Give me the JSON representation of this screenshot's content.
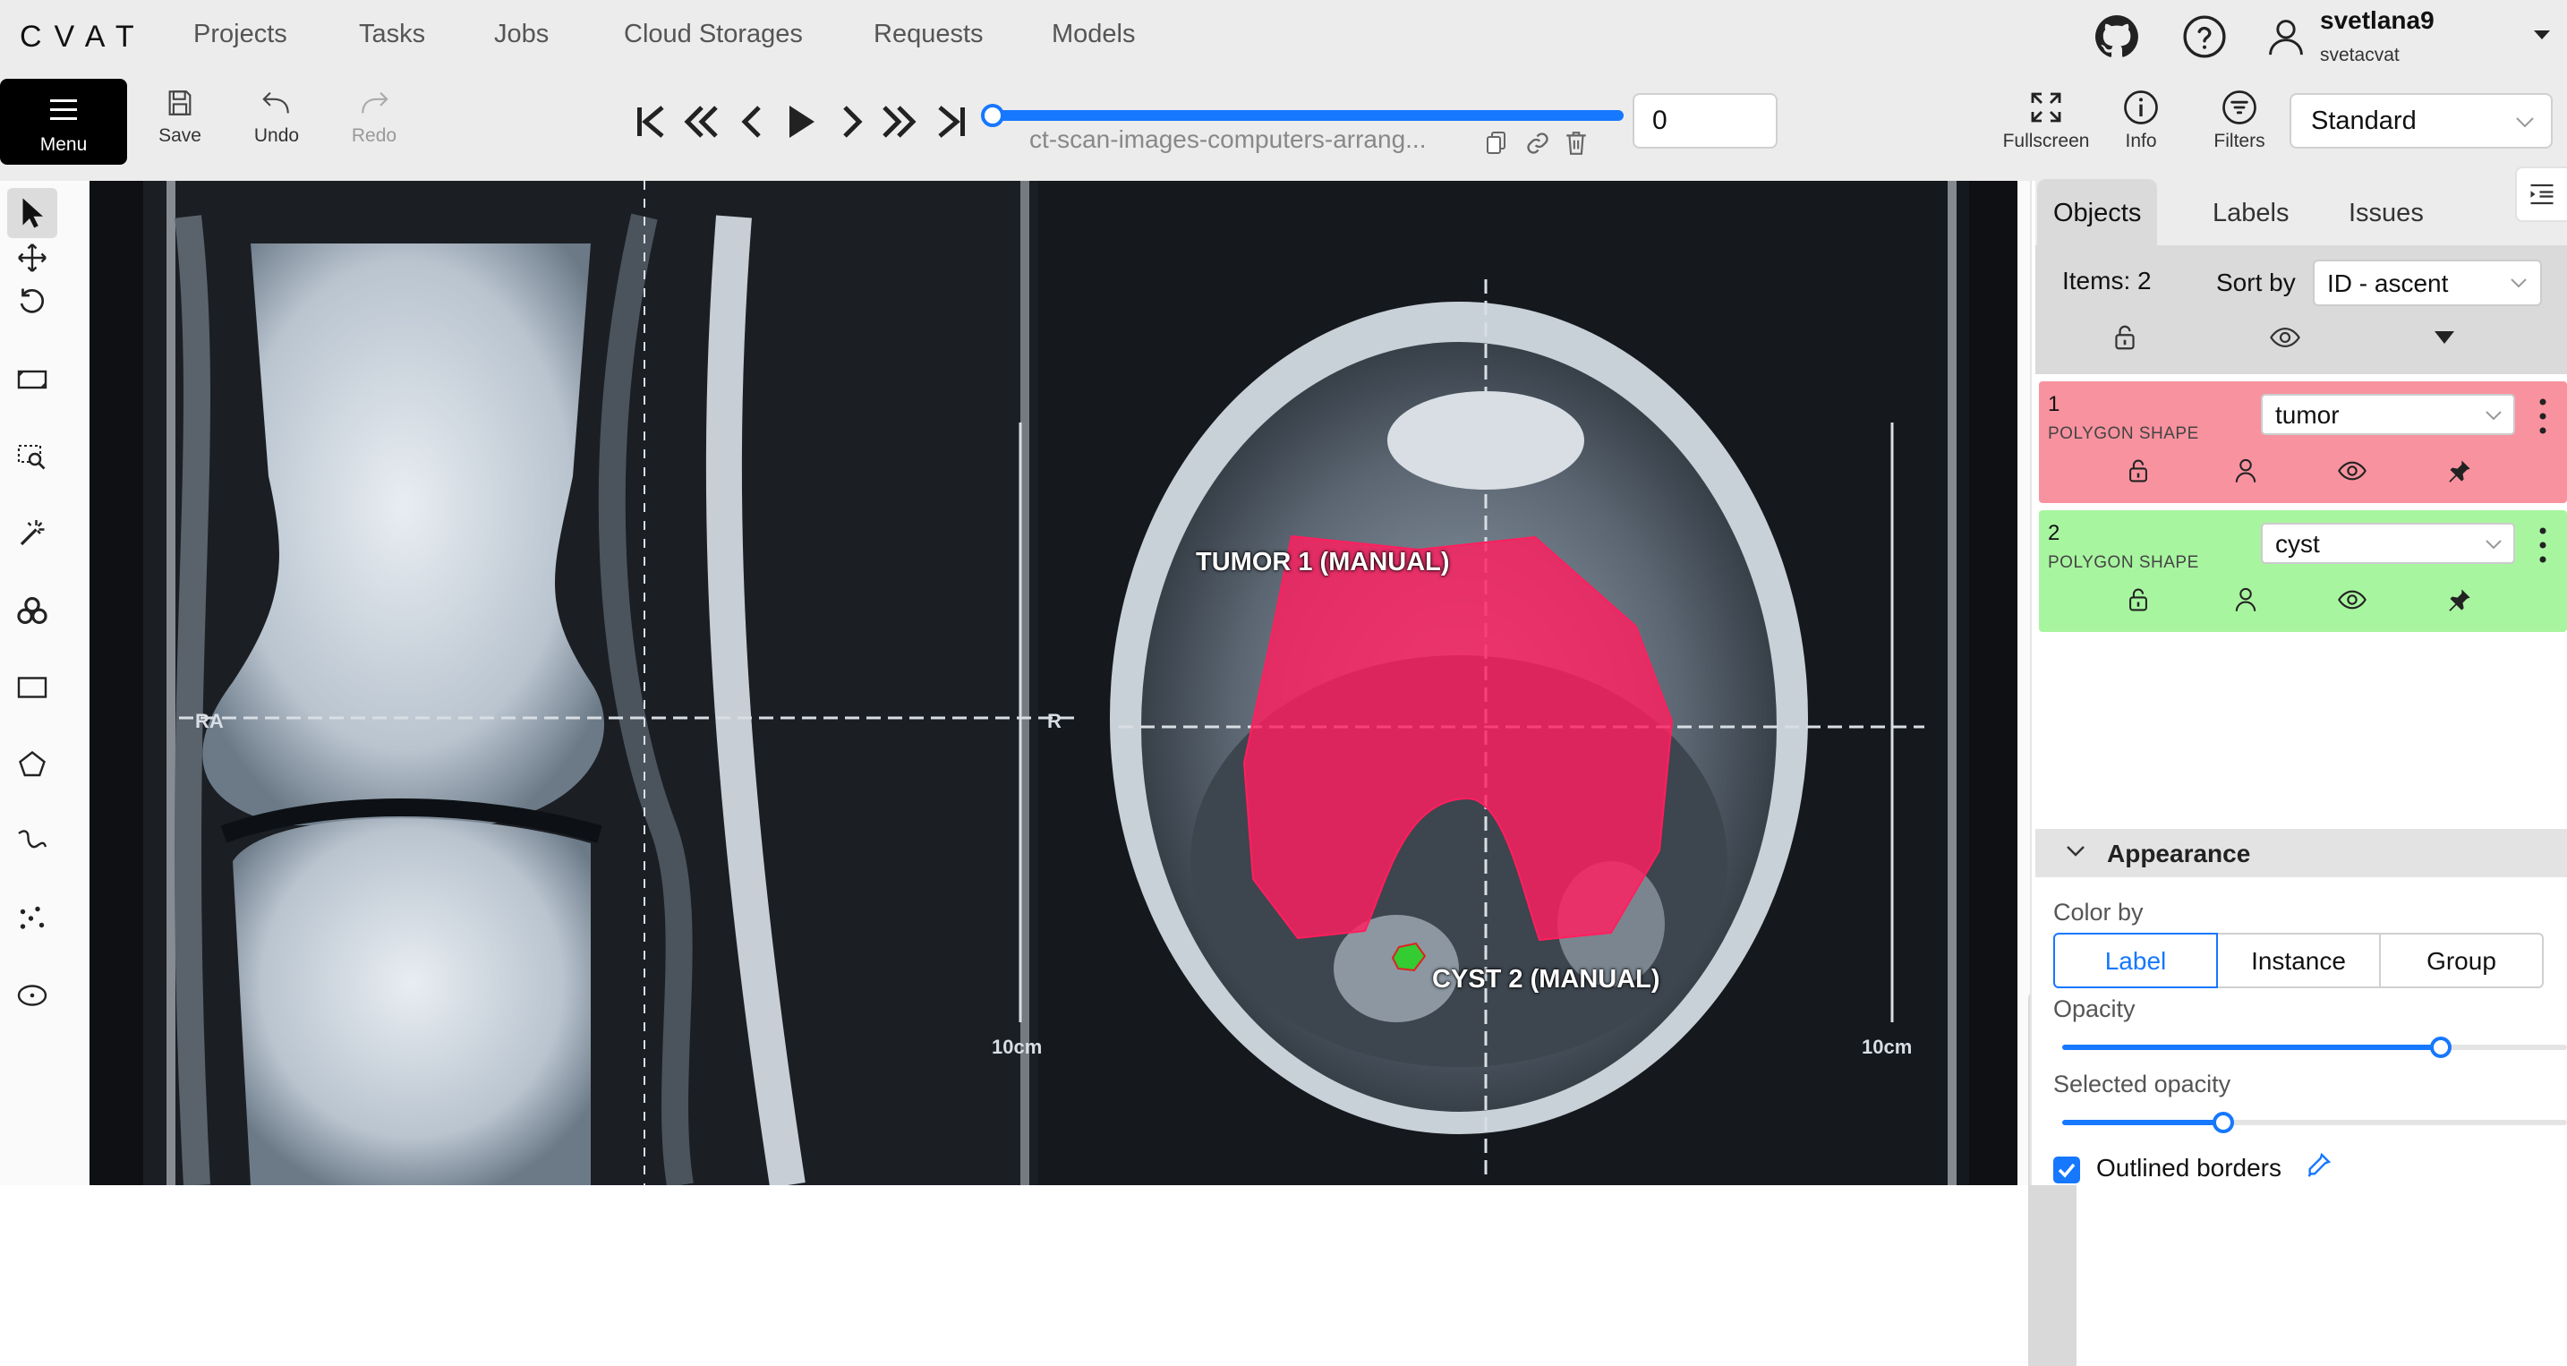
{
  "app": {
    "logo": "CVAT"
  },
  "nav": {
    "links": [
      "Projects",
      "Tasks",
      "Jobs",
      "Cloud Storages",
      "Requests",
      "Models"
    ],
    "user": {
      "name": "svetlana9",
      "org": "svetacvat"
    }
  },
  "toolbar": {
    "menu_label": "Menu",
    "save_label": "Save",
    "undo_label": "Undo",
    "redo_label": "Redo",
    "job_name": "ct-scan-images-computers-arrang...",
    "frame_value": "0",
    "frame_progress": 0,
    "fullscreen_label": "Fullscreen",
    "info_label": "Info",
    "filters_label": "Filters",
    "workspace": "Standard"
  },
  "canvas": {
    "annotations": [
      {
        "text": "TUMOR 1 (MANUAL)",
        "color": "#ff2d6a"
      },
      {
        "text": "CYST 2 (MANUAL)",
        "color": "#33cc33"
      }
    ]
  },
  "sidebar": {
    "tabs": [
      "Objects",
      "Labels",
      "Issues"
    ],
    "active_tab": "Objects",
    "items_count": "Items: 2",
    "sort_label": "Sort by",
    "sort_value": "ID - ascent",
    "objects": [
      {
        "id": "1",
        "type": "POLYGON SHAPE",
        "label": "tumor",
        "color": "#f8929f"
      },
      {
        "id": "2",
        "type": "POLYGON SHAPE",
        "label": "cyst",
        "color": "#a8f5a0"
      }
    ],
    "appearance": {
      "title": "Appearance",
      "color_by_label": "Color by",
      "color_by_options": [
        "Label",
        "Instance",
        "Group"
      ],
      "color_by_selected": "Label",
      "opacity_label": "Opacity",
      "opacity_value": 0.75,
      "selected_opacity_label": "Selected opacity",
      "selected_opacity_value": 0.32,
      "outlined_borders_label": "Outlined borders",
      "outlined_borders_checked": true
    }
  },
  "colors": {
    "accent": "#1677ff",
    "menu_bg": "#000000"
  }
}
